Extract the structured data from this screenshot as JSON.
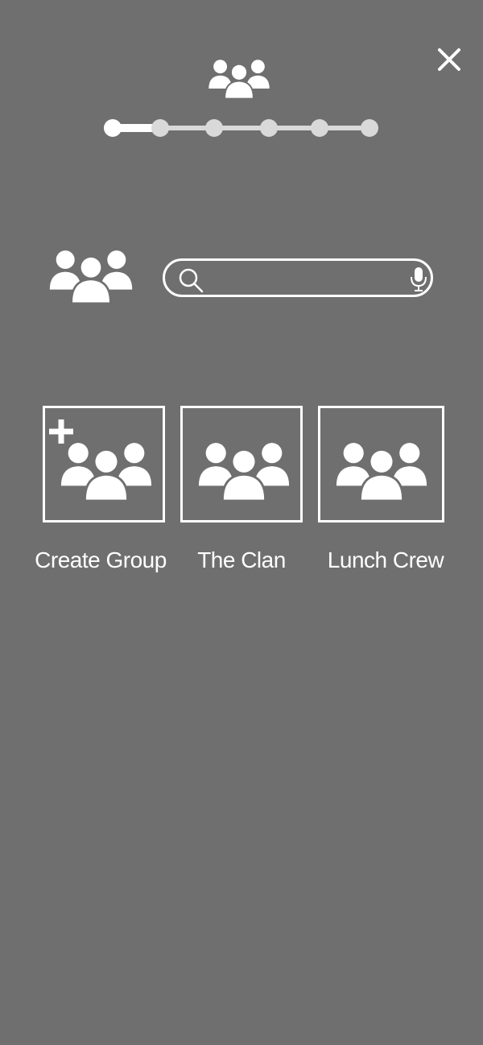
{
  "header": {
    "close_icon": "close-icon",
    "group_icon": "group-icon",
    "progress": {
      "total_steps": 6,
      "current_step": 1
    }
  },
  "search": {
    "placeholder": "",
    "value": "",
    "search_icon": "search-icon",
    "mic_icon": "microphone-icon"
  },
  "groups": [
    {
      "label": "Create Group",
      "icon": "group-add-icon"
    },
    {
      "label": "The Clan",
      "icon": "group-icon"
    },
    {
      "label": "Lunch Crew",
      "icon": "group-icon"
    }
  ],
  "colors": {
    "background": "#6f6f6f",
    "foreground": "#ffffff",
    "inactive": "#d9d9d9"
  }
}
